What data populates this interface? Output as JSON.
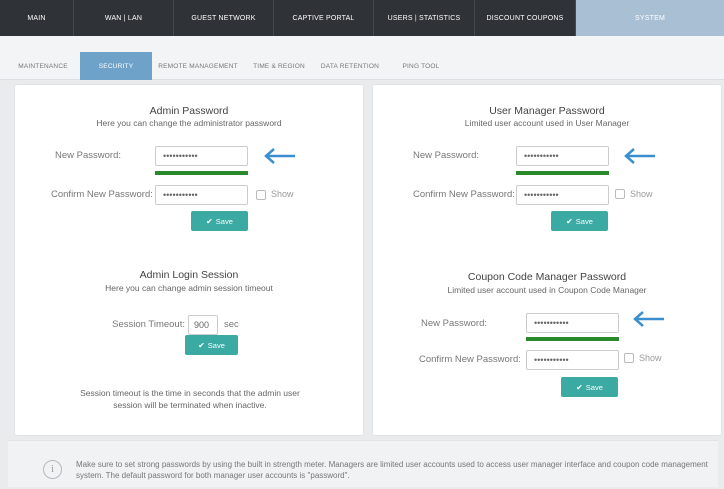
{
  "topnav": {
    "tabs": [
      {
        "label": "MAIN"
      },
      {
        "label": "WAN | LAN"
      },
      {
        "label": "GUEST NETWORK"
      },
      {
        "label": "CAPTIVE PORTAL"
      },
      {
        "label": "USERS | STATISTICS"
      },
      {
        "label": "DISCOUNT COUPONS"
      },
      {
        "label": "SYSTEM"
      }
    ],
    "active": "SYSTEM"
  },
  "subnav": {
    "tabs": [
      {
        "label": "MAINTENANCE"
      },
      {
        "label": "SECURITY"
      },
      {
        "label": "REMOTE MANAGEMENT"
      },
      {
        "label": "TIME & REGION"
      },
      {
        "label": "DATA RETENTION"
      },
      {
        "label": "PING TOOL"
      }
    ],
    "active": "SECURITY"
  },
  "admin_password": {
    "title": "Admin Password",
    "subtitle": "Here you can change the administrator password",
    "new_label": "New Password:",
    "new_value": "•••••••••••",
    "confirm_label": "Confirm New Password:",
    "confirm_value": "•••••••••••",
    "show_label": "Show",
    "save_label": "Save"
  },
  "admin_session": {
    "title": "Admin Login Session",
    "subtitle": "Here you can change admin session timeout",
    "timeout_label": "Session Timeout:",
    "timeout_value": "900",
    "unit": "sec",
    "save_label": "Save",
    "note": "Session timeout is the time in seconds that the admin user session will be terminated when inactive."
  },
  "user_manager_password": {
    "title": "User Manager Password",
    "subtitle": "Limited user account used in User Manager",
    "new_label": "New Password:",
    "new_value": "•••••••••••",
    "confirm_label": "Confirm New Password:",
    "confirm_value": "•••••••••••",
    "show_label": "Show",
    "save_label": "Save"
  },
  "coupon_manager_password": {
    "title": "Coupon Code Manager Password",
    "subtitle": "Limited user account used in Coupon Code Manager",
    "new_label": "New Password:",
    "new_value": "•••••••••••",
    "confirm_label": "Confirm New Password:",
    "confirm_value": "•••••••••••",
    "show_label": "Show",
    "save_label": "Save"
  },
  "info": {
    "icon": "info-icon",
    "text": "Make sure to set strong passwords by using the built in strength meter. Managers are limited user accounts used to access user manager interface and coupon code management system. The default password for both manager user accounts is \"password\"."
  },
  "colors": {
    "active_top_tab": "#a9bfd4",
    "active_sub_tab": "#6fa2c9",
    "save_button": "#3aaaa2",
    "strength_meter": "#2a8a2a",
    "arrow": "#3a8fd0"
  }
}
